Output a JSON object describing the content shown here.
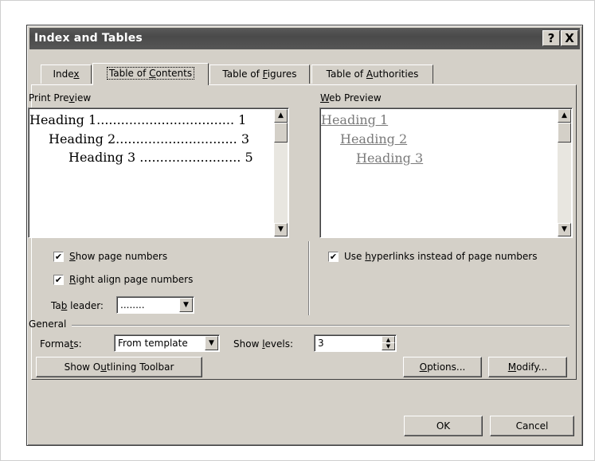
{
  "dialog": {
    "title": "Index and Tables",
    "help_button": "?",
    "close_button": "X"
  },
  "tabs": [
    {
      "pre": "Inde",
      "acc": "x",
      "post": ""
    },
    {
      "pre": "Table of ",
      "acc": "C",
      "post": "ontents"
    },
    {
      "pre": "Table of ",
      "acc": "F",
      "post": "igures"
    },
    {
      "pre": "Table of ",
      "acc": "A",
      "post": "uthorities"
    }
  ],
  "print_preview": {
    "label_pre": "Print Pre",
    "label_acc": "v",
    "label_post": "iew",
    "lines": [
      {
        "text": "Heading 1",
        "leader": "..................................",
        "page": "1"
      },
      {
        "text": "Heading 2",
        "leader": "..............................",
        "page": "3"
      },
      {
        "text": "Heading 3",
        "leader": ".........................",
        "page": "5"
      }
    ]
  },
  "web_preview": {
    "label_pre": "",
    "label_acc": "W",
    "label_post": "eb Preview",
    "lines": [
      "Heading 1",
      "Heading 2",
      "Heading 3"
    ]
  },
  "options": {
    "show_page_numbers": {
      "pre": "",
      "acc": "S",
      "post": "how page numbers",
      "checked": "✔"
    },
    "right_align": {
      "pre": "",
      "acc": "R",
      "post": "ight align page numbers",
      "checked": "✔"
    },
    "use_hyperlinks": {
      "pre": "Use ",
      "acc": "h",
      "post": "yperlinks instead of page numbers",
      "checked": "✔"
    },
    "tab_leader": {
      "pre": "Ta",
      "acc": "b",
      "post": " leader:",
      "value": "........"
    }
  },
  "general": {
    "label": "General",
    "formats": {
      "pre": "Forma",
      "acc": "t",
      "post": "s:",
      "value": "From template"
    },
    "show_levels": {
      "pre": "Show ",
      "acc": "l",
      "post": "evels:",
      "value": "3"
    }
  },
  "buttons": {
    "show_outlining": {
      "pre": "Show O",
      "acc": "u",
      "post": "tlining Toolbar"
    },
    "options": {
      "pre": "",
      "acc": "O",
      "post": "ptions..."
    },
    "modify": {
      "pre": "",
      "acc": "M",
      "post": "odify..."
    },
    "ok": "OK",
    "cancel": "Cancel"
  },
  "icons": {
    "scroll_up": "▲",
    "scroll_down": "▼",
    "dropdown": "▼",
    "spin_up": "▲",
    "spin_down": "▼"
  }
}
